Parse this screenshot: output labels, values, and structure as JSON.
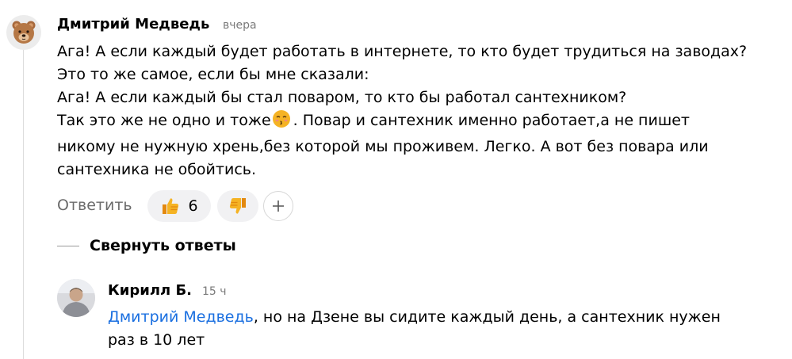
{
  "comment": {
    "author": "Дмитрий Медведь",
    "time": "вчера",
    "avatar_icon": "bear-face-icon",
    "lines": [
      "Ага! А если каждый будет работать в интернете, то кто будет трудиться на заводах?",
      "Это то же самое, если бы мне сказали:",
      "Ага! А если каждый бы стал поваром, то кто бы работал сантехником?",
      "Так это же не одно и тоже",
      ". Повар и сантехник именно работает,а не пишет",
      "никому не нужную хрень,без которой мы проживем. Легко. А вот без повара или",
      "сантехника не обойтись."
    ],
    "inline_emoji": "kissing-face-emoji",
    "actions": {
      "reply_label": "Ответить",
      "like_count": "6",
      "like_icon": "thumbs-up-icon",
      "dislike_icon": "thumbs-down-icon",
      "add_reaction_icon": "plus-icon"
    }
  },
  "collapse_replies_label": "Свернуть ответы",
  "reply": {
    "author": "Кирилл Б.",
    "time": "15 ч",
    "avatar_icon": "user-photo-avatar",
    "mention": "Дмитрий Медведь",
    "text_part1": ", но на Дзене вы сидите каждый день, а сантехник нужен",
    "text_line2": "раз в 10 лет"
  },
  "colors": {
    "link": "#1a6fe0",
    "muted_text": "#6b6b6b",
    "pill_background": "#f1f1f3",
    "emoji_yellow": "#f5b324"
  }
}
